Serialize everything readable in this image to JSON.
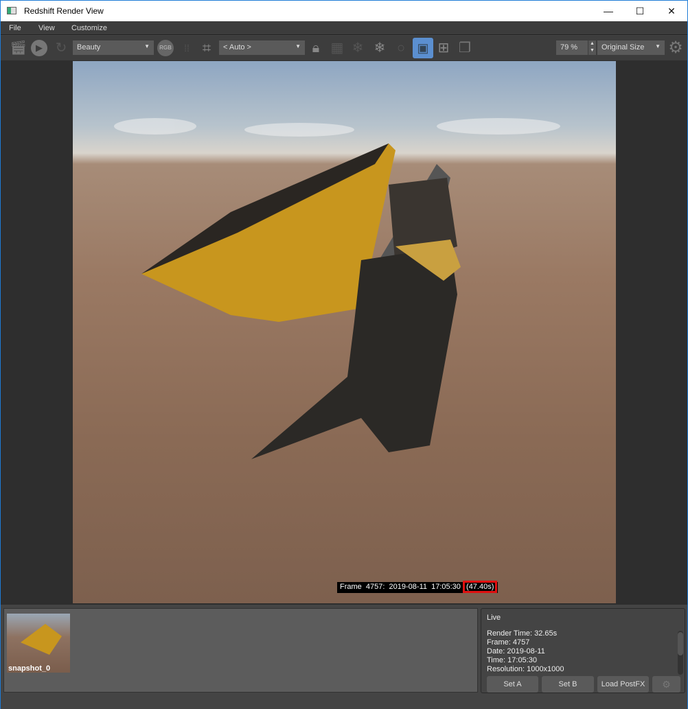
{
  "window": {
    "title": "Redshift Render View",
    "minimize": "—",
    "maximize": "☐",
    "close": "✕"
  },
  "menu": [
    "File",
    "View",
    "Customize"
  ],
  "toolbar": {
    "aov": "Beauty",
    "rgb": "RGB",
    "region": "< Auto >",
    "zoom": "79 %",
    "size_mode": "Original Size",
    "active_color": "#5b8fd0"
  },
  "render": {
    "caption_prefix": "Frame  4757:  2019-08-11  17:05:30  ",
    "caption_time": "(47.40s)",
    "highlight_color": "#e01010"
  },
  "snapshots": [
    {
      "label": "snapshot_0"
    }
  ],
  "info": {
    "mode": "Live",
    "lines": [
      "Render Time: 32.65s",
      "Frame: 4757",
      "Date: 2019-08-11",
      "Time: 17:05:30",
      "Resolution: 1000x1000"
    ]
  },
  "buttons": {
    "set_a": "Set A",
    "set_b": "Set B",
    "load_postfx": "Load PostFX"
  }
}
